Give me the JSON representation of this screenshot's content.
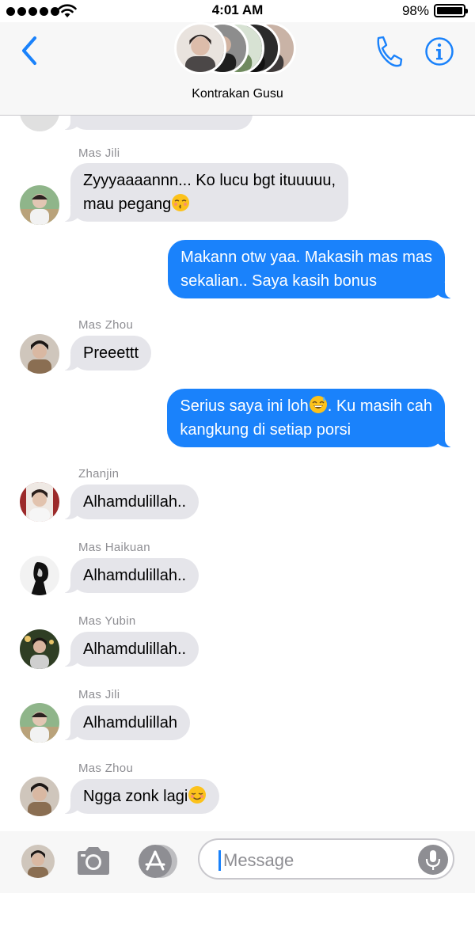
{
  "status_bar": {
    "time": "4:01 AM",
    "battery_percent": "98%",
    "signal_dots": 5,
    "icons": [
      "signal-dots",
      "wifi-icon",
      "battery-icon"
    ]
  },
  "header": {
    "group_name": "Kontrakan Gusu",
    "icons": [
      "chevron-left-icon",
      "phone-icon",
      "info-icon"
    ],
    "accent_color": "#1a82fb"
  },
  "messages": [
    {
      "direction": "in",
      "sender": "Mas Jili",
      "lines": [
        "Zyyyaaaannn... Ko lucu bgt ituuuuu,",
        "mau pegang"
      ],
      "emoji": "kissing-closed-eyes"
    },
    {
      "direction": "out",
      "sender": "",
      "lines": [
        "Makann otw yaa. Makasih mas mas",
        "sekalian.. Saya kasih bonus"
      ]
    },
    {
      "direction": "in",
      "sender": "Mas Zhou",
      "lines": [
        "Preeettt"
      ]
    },
    {
      "direction": "out",
      "sender": "",
      "lines": [
        "Serius saya ini loh",
        ". Ku masih cah",
        "kangkung di setiap porsi"
      ],
      "emoji": "grinning-sweat"
    },
    {
      "direction": "in",
      "sender": "Zhanjin",
      "lines": [
        "Alhamdulillah.."
      ]
    },
    {
      "direction": "in",
      "sender": "Mas Haikuan",
      "lines": [
        "Alhamdulillah.."
      ]
    },
    {
      "direction": "in",
      "sender": "Mas Yubin",
      "lines": [
        "Alhamdulillah.."
      ]
    },
    {
      "direction": "in",
      "sender": "Mas Jili",
      "lines": [
        "Alhamdulillah"
      ]
    },
    {
      "direction": "in",
      "sender": "Mas Zhou",
      "lines": [
        "Ngga zonk lagi"
      ],
      "emoji": "relieved"
    }
  ],
  "compose": {
    "placeholder": "Message",
    "icons": [
      "camera-icon",
      "app-store-icon",
      "microphone-icon"
    ]
  },
  "colors": {
    "incoming_bubble": "#e5e5ea",
    "outgoing_bubble": "#1a82fb",
    "sender_label": "#8e8e93"
  }
}
